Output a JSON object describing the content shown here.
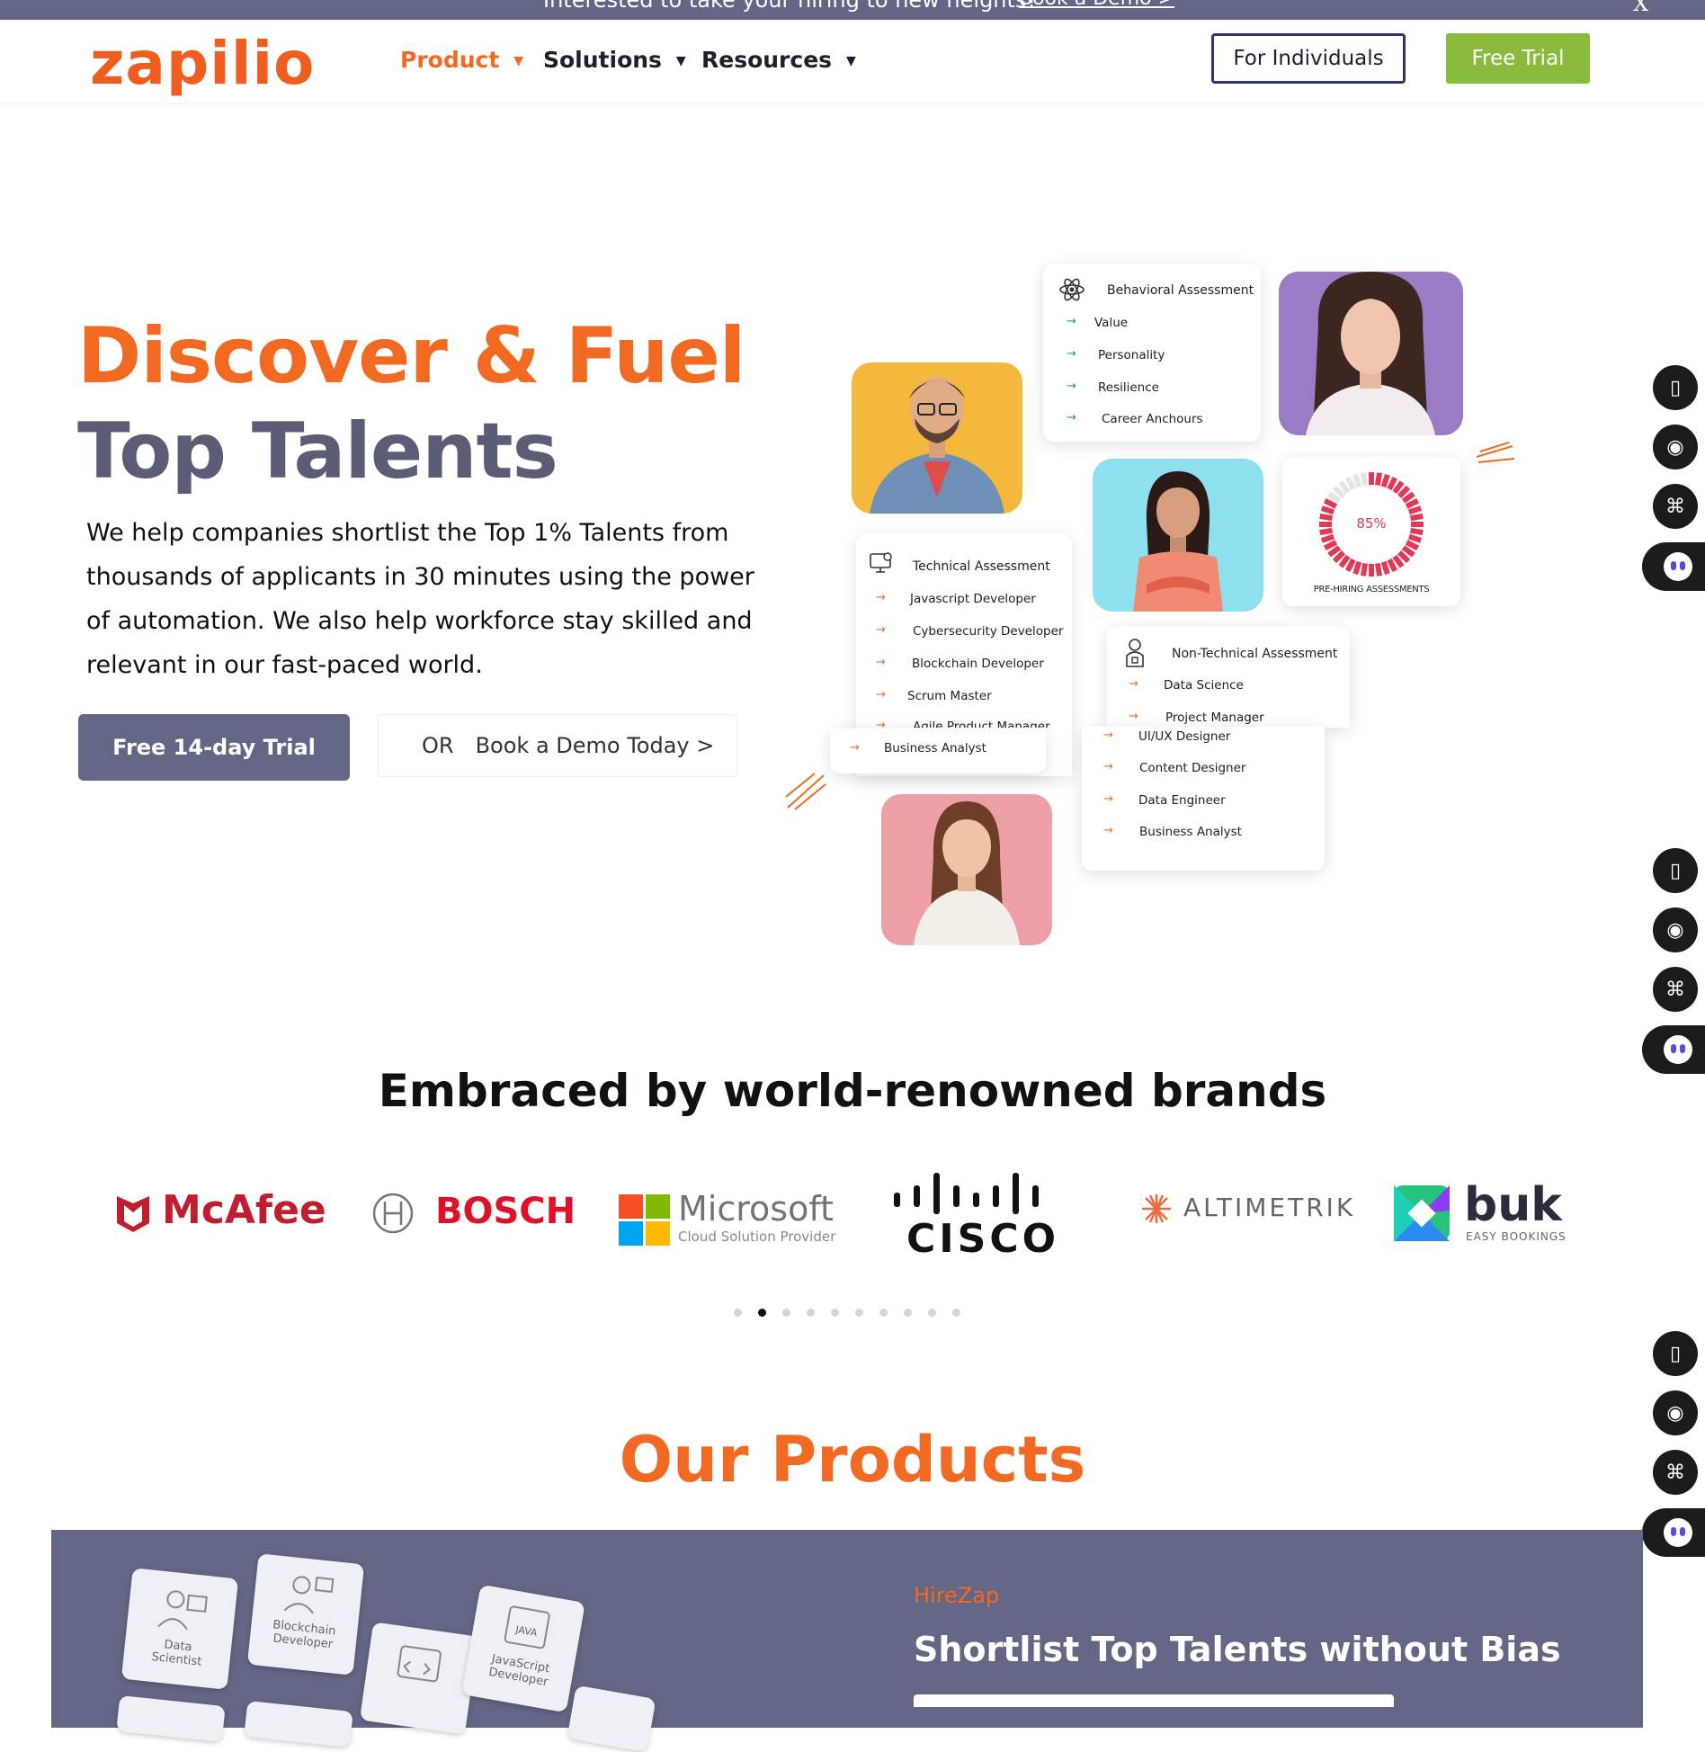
{
  "announcement": {
    "text": "Interested to take your hiring to new heights?",
    "link": "Book a Demo >",
    "close": "X"
  },
  "header": {
    "logo": "zapilio",
    "nav": [
      {
        "label": "Product"
      },
      {
        "label": "Solutions"
      },
      {
        "label": "Resources"
      }
    ],
    "for_individuals": "For Individuals",
    "free_trial": "Free Trial"
  },
  "hero": {
    "title_line1": "Discover & Fuel",
    "title_line2": "Top Talents",
    "lead": "We help companies shortlist the Top 1% Talents from thousands of applicants in 30 minutes using the power of automation. We also help workforce stay skilled and relevant in our fast-paced world.",
    "trial_button": "Free 14-day Trial",
    "or": "OR",
    "demo_link": "Book a Demo Today >"
  },
  "cards": {
    "behavioral": {
      "title": "Behavioral Assessment",
      "items": [
        "Value",
        "Personality",
        "Resilience",
        "Career Anchours"
      ]
    },
    "technical": {
      "title": "Technical Assessment",
      "items": [
        "Javascript Developer",
        "Cybersecurity Developer",
        "Blockchain Developer",
        "Scrum Master",
        "Agile Product Manager",
        "Business Analyst"
      ]
    },
    "nontechnical": {
      "title": "Non-Technical Assessment",
      "items": [
        "Data Science",
        "Project Manager",
        "UI/UX Designer",
        "Content Designer",
        "Data Engineer",
        "Business Analyst"
      ]
    },
    "prehiring": {
      "percent": "85%",
      "label": "PRE-HIRING ASSESSMENTS",
      "value": 0.85
    }
  },
  "brands": {
    "title": "Embraced by world-renowned brands",
    "logos": [
      "McAfee",
      "BOSCH",
      "Microsoft",
      "Cloud Solution Provider",
      "CISCO",
      "ALTIMETRIK",
      "buk",
      "EASY BOOKINGS"
    ],
    "active_dot": 2,
    "dot_count": 10
  },
  "products": {
    "title": "Our Products",
    "name": "HireZap",
    "headline": "Shortlist Top Talents without Bias",
    "tiles": [
      "Data Scientist",
      "Blockchain Developer",
      "JavaScript Developer",
      "JAVA"
    ]
  },
  "colors": {
    "brand": "#f26a22",
    "slate": "#636684",
    "green": "#8bbb3c",
    "navy": "#2d3476"
  }
}
